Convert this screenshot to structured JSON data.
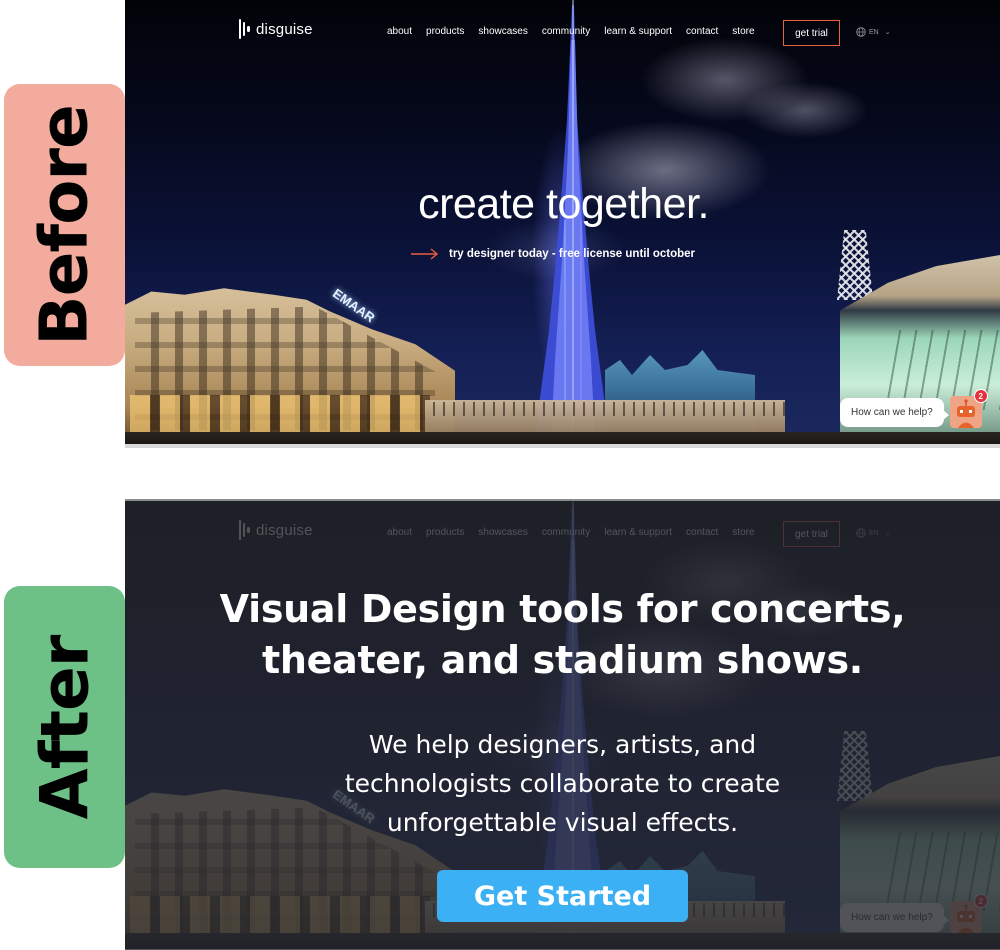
{
  "labels": {
    "before": "Before",
    "after": "After",
    "before_color": "#f2ab9c",
    "after_color": "#6dc187"
  },
  "site": {
    "logo_text": "disguise",
    "nav": [
      "about",
      "products",
      "showcases",
      "community",
      "learn & support",
      "contact",
      "store"
    ],
    "trial_button": "get trial",
    "language": "EN",
    "accent_color": "#e4603f"
  },
  "before": {
    "hero_title": "create together.",
    "hero_cta": "try designer today - free license until october",
    "building_sign": "EMAAR"
  },
  "after": {
    "headline_line1": "Visual Design tools for concerts,",
    "headline_line2": "theater, and stadium shows.",
    "subtext_line1": "We help designers, artists, and",
    "subtext_line2": "technologists collaborate to create",
    "subtext_line3": "unforgettable visual effects.",
    "cta_button": "Get Started",
    "cta_color": "#3bb0f4"
  },
  "chat": {
    "prompt": "How can we help?",
    "badge_count": "2",
    "bot_color": "#f0a486"
  }
}
